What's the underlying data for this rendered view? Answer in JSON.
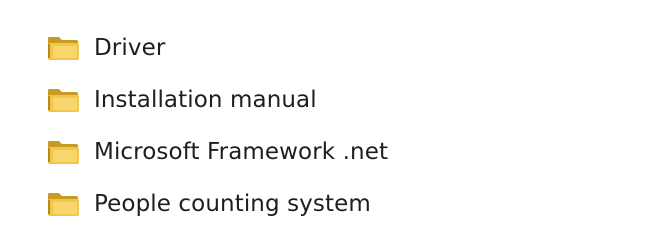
{
  "file_list": {
    "items": [
      {
        "label": "Driver",
        "icon": "folder-icon"
      },
      {
        "label": "Installation manual",
        "icon": "folder-icon"
      },
      {
        "label": "Microsoft Framework .net",
        "icon": "folder-icon"
      },
      {
        "label": "People counting system",
        "icon": "folder-icon"
      }
    ]
  },
  "colors": {
    "folder_body": "#f2c64a",
    "folder_dark": "#c99a22",
    "folder_light": "#ffe38a",
    "text": "#1e1e1e",
    "background": "#ffffff"
  }
}
